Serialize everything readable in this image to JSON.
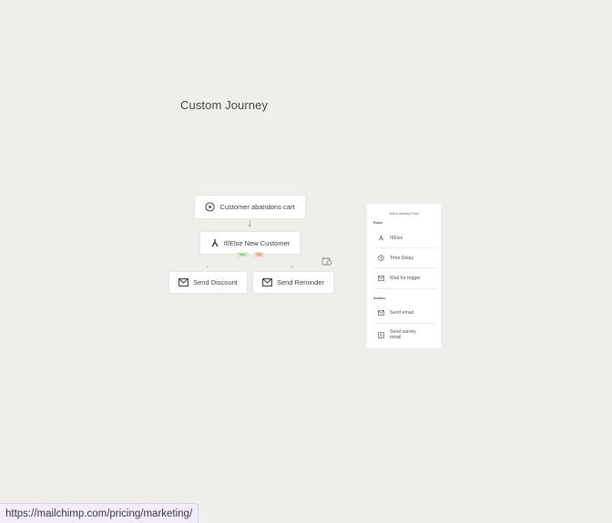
{
  "page": {
    "title": "Custom Journey"
  },
  "journey": {
    "trigger_label": "Customer abandons cart",
    "condition_label": "If/Else New Customer",
    "branch_yes": "Yes",
    "branch_no": "No",
    "left_action_label": "Send Discount",
    "right_action_label": "Send Reminder"
  },
  "panel": {
    "title": "Add a Journey Point",
    "rules_label": "Rules",
    "actions_label": "Actions",
    "rules": [
      {
        "label": "If/Else",
        "icon": "branch-icon"
      },
      {
        "label": "Time Delay",
        "icon": "clock-icon"
      },
      {
        "label": "Wait for trigger",
        "icon": "wait-icon"
      }
    ],
    "actions": [
      {
        "label": "Send email",
        "icon": "envelope-icon"
      },
      {
        "label": "Send survey email",
        "icon": "survey-icon"
      }
    ]
  },
  "status_bar": {
    "url": "https://mailchimp.com/pricing/marketing/"
  },
  "colors": {
    "background": "#efeeea",
    "yes_badge": "#d7ecd0",
    "no_badge": "#f5d4ca",
    "status_bar": "#f2ecfb"
  }
}
